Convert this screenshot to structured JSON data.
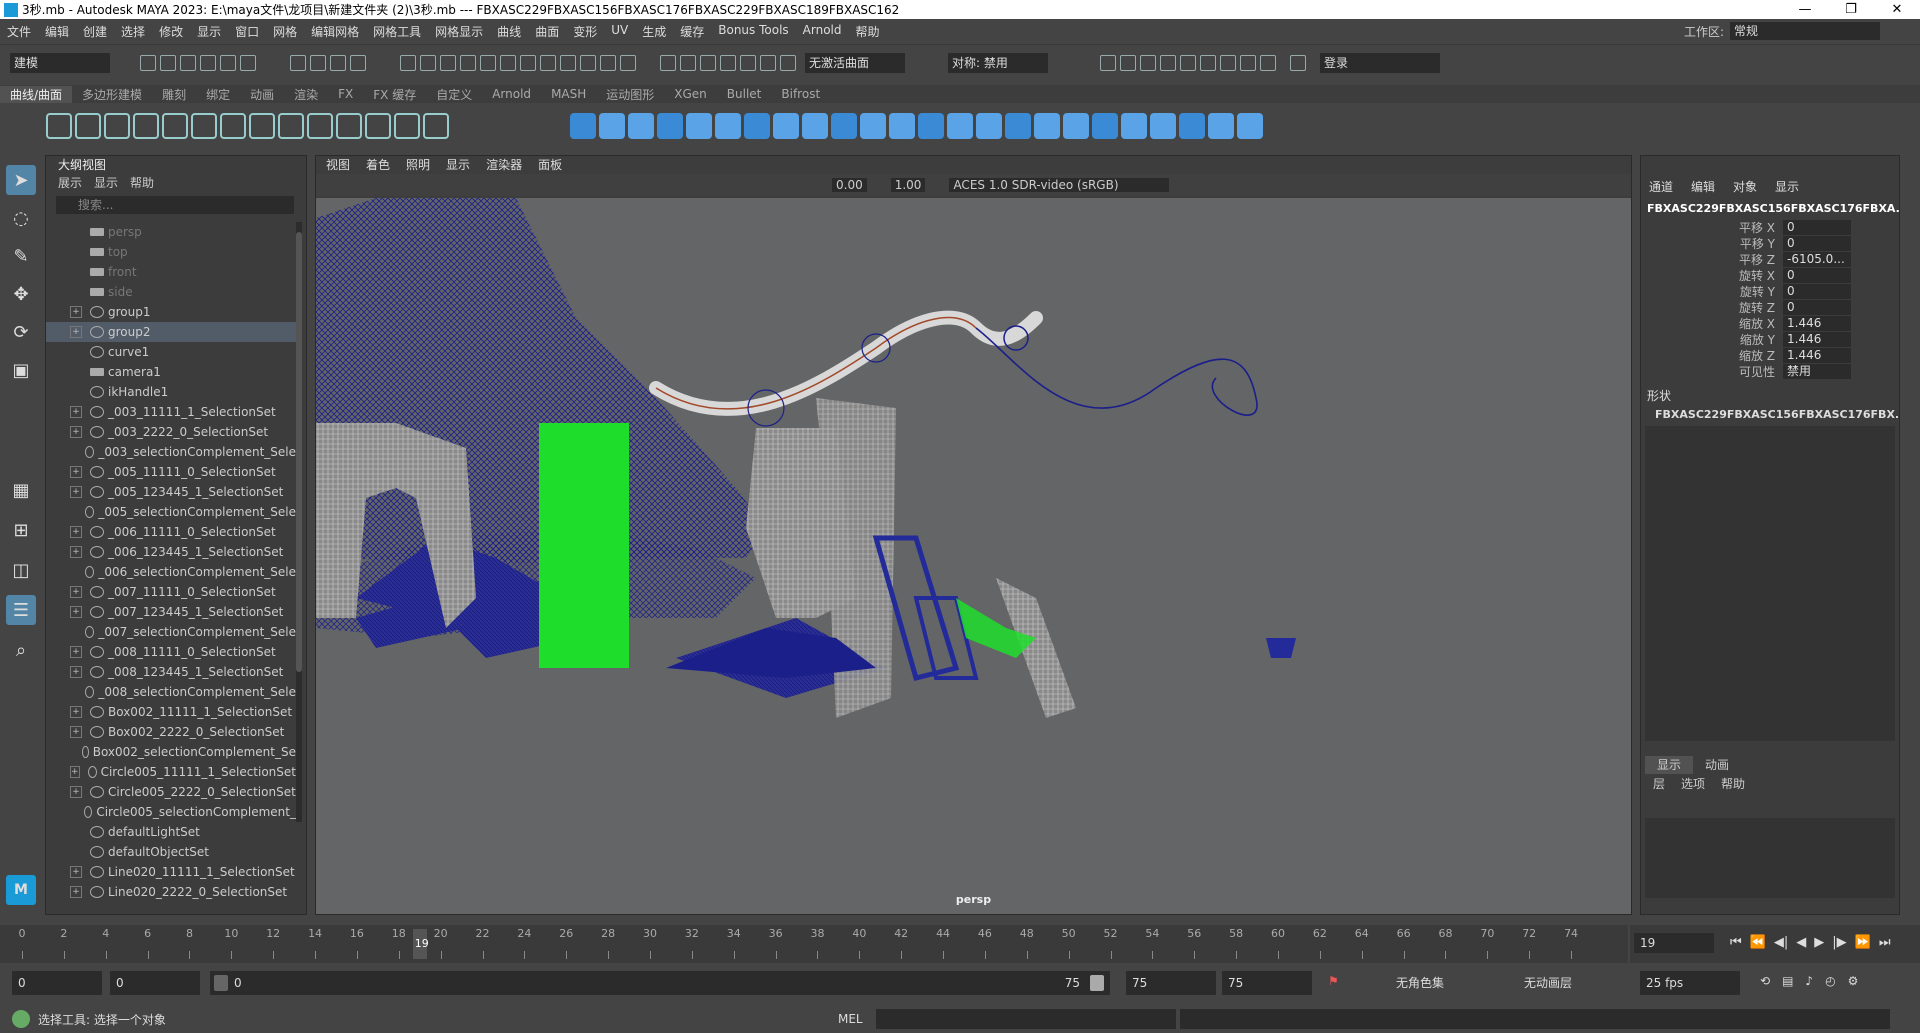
{
  "window": {
    "title": "3秒.mb - Autodesk MAYA 2023: E:\\maya文件\\龙项目\\新建文件夹 (2)\\3秒.mb   ---   FBXASC229FBXASC156FBXASC176FBXASC229FBXASC189FBXASC162",
    "minimize": "—",
    "maximize": "❐",
    "close": "✕"
  },
  "menubar": {
    "items": [
      "文件",
      "编辑",
      "创建",
      "选择",
      "修改",
      "显示",
      "窗口",
      "网格",
      "编辑网格",
      "网格工具",
      "网格显示",
      "曲线",
      "曲面",
      "变形",
      "UV",
      "生成",
      "缓存",
      "Bonus Tools",
      "Arnold",
      "帮助"
    ],
    "workspace_label": "工作区:",
    "workspace_value": "常规"
  },
  "statusline": {
    "mode": "建模",
    "live_surface": "无激活曲面",
    "symmetry": "对称: 禁用",
    "login": "登录"
  },
  "shelf": {
    "tabs": [
      "曲线/曲面",
      "多边形建模",
      "雕刻",
      "绑定",
      "动画",
      "渲染",
      "FX",
      "FX 缓存",
      "自定义",
      "Arnold",
      "MASH",
      "运动图形",
      "XGen",
      "Bullet",
      "Bifrost"
    ],
    "active_tab": 0
  },
  "outliner": {
    "title": "大纲视图",
    "menu": [
      "展示",
      "显示",
      "帮助"
    ],
    "search_placeholder": "搜索...",
    "rows": [
      {
        "label": "persp",
        "type": "cam",
        "dim": true,
        "expand": false
      },
      {
        "label": "top",
        "type": "cam",
        "dim": true,
        "expand": false
      },
      {
        "label": "front",
        "type": "cam",
        "dim": true,
        "expand": false
      },
      {
        "label": "side",
        "type": "cam",
        "dim": true,
        "expand": false
      },
      {
        "label": "group1",
        "type": "grp",
        "expand": true
      },
      {
        "label": "group2",
        "type": "grp",
        "expand": true,
        "selected": true
      },
      {
        "label": "curve1",
        "type": "crv",
        "expand": false
      },
      {
        "label": "camera1",
        "type": "cam",
        "expand": false
      },
      {
        "label": "ikHandle1",
        "type": "ik",
        "expand": false
      },
      {
        "label": "_003_11111_1_SelectionSet",
        "type": "set",
        "expand": true
      },
      {
        "label": "_003_2222_0_SelectionSet",
        "type": "set",
        "expand": true
      },
      {
        "label": "_003_selectionComplement_Sele",
        "type": "set",
        "expand": false
      },
      {
        "label": "_005_11111_0_SelectionSet",
        "type": "set",
        "expand": true
      },
      {
        "label": "_005_123445_1_SelectionSet",
        "type": "set",
        "expand": true
      },
      {
        "label": "_005_selectionComplement_Sele",
        "type": "set",
        "expand": false
      },
      {
        "label": "_006_11111_0_SelectionSet",
        "type": "set",
        "expand": true
      },
      {
        "label": "_006_123445_1_SelectionSet",
        "type": "set",
        "expand": true
      },
      {
        "label": "_006_selectionComplement_Sele",
        "type": "set",
        "expand": false
      },
      {
        "label": "_007_11111_0_SelectionSet",
        "type": "set",
        "expand": true
      },
      {
        "label": "_007_123445_1_SelectionSet",
        "type": "set",
        "expand": true
      },
      {
        "label": "_007_selectionComplement_Sele",
        "type": "set",
        "expand": false
      },
      {
        "label": "_008_11111_0_SelectionSet",
        "type": "set",
        "expand": true
      },
      {
        "label": "_008_123445_1_SelectionSet",
        "type": "set",
        "expand": true
      },
      {
        "label": "_008_selectionComplement_Sele",
        "type": "set",
        "expand": false
      },
      {
        "label": "Box002_11111_1_SelectionSet",
        "type": "set",
        "expand": true
      },
      {
        "label": "Box002_2222_0_SelectionSet",
        "type": "set",
        "expand": true
      },
      {
        "label": "Box002_selectionComplement_Se",
        "type": "set",
        "expand": false
      },
      {
        "label": "Circle005_11111_1_SelectionSet",
        "type": "set",
        "expand": true
      },
      {
        "label": "Circle005_2222_0_SelectionSet",
        "type": "set",
        "expand": true
      },
      {
        "label": "Circle005_selectionComplement_",
        "type": "set",
        "expand": false
      },
      {
        "label": "defaultLightSet",
        "type": "set",
        "expand": false
      },
      {
        "label": "defaultObjectSet",
        "type": "set",
        "expand": false
      },
      {
        "label": "Line020_11111_1_SelectionSet",
        "type": "set",
        "expand": true
      },
      {
        "label": "Line020_2222_0_SelectionSet",
        "type": "set",
        "expand": true
      }
    ]
  },
  "viewport": {
    "menu": [
      "视图",
      "着色",
      "照明",
      "显示",
      "渲染器",
      "面板"
    ],
    "exposure": "0.00",
    "gamma": "1.00",
    "color_space": "ACES 1.0 SDR-video (sRGB)",
    "camera": "persp"
  },
  "channelbox": {
    "menu": [
      "通道",
      "编辑",
      "对象",
      "显示"
    ],
    "object": "FBXASC229FBXASC156FBXASC176FBXA...",
    "attrs": [
      {
        "label": "平移 X",
        "value": "0"
      },
      {
        "label": "平移 Y",
        "value": "0"
      },
      {
        "label": "平移 Z",
        "value": "-6105.0..."
      },
      {
        "label": "旋转 X",
        "value": "0"
      },
      {
        "label": "旋转 Y",
        "value": "0"
      },
      {
        "label": "旋转 Z",
        "value": "0"
      },
      {
        "label": "缩放 X",
        "value": "1.446"
      },
      {
        "label": "缩放 Y",
        "value": "1.446"
      },
      {
        "label": "缩放 Z",
        "value": "1.446"
      },
      {
        "label": "可见性",
        "value": "禁用"
      }
    ],
    "shapes_label": "形状",
    "shape_object": "FBXASC229FBXASC156FBXASC176FBX...",
    "layer_tabs": [
      "显示",
      "动画"
    ],
    "layer_menu": [
      "层",
      "选项",
      "帮助"
    ]
  },
  "timeline": {
    "ticks": [
      "0",
      "2",
      "4",
      "6",
      "8",
      "10",
      "12",
      "14",
      "16",
      "18",
      "20",
      "22",
      "24",
      "26",
      "28",
      "30",
      "32",
      "34",
      "36",
      "38",
      "40",
      "42",
      "44",
      "46",
      "48",
      "50",
      "52",
      "54",
      "56",
      "58",
      "60",
      "62",
      "64",
      "66",
      "68",
      "70",
      "72",
      "74"
    ],
    "current_frame": "19",
    "current_frame_field": "19"
  },
  "range": {
    "start_anim": "0",
    "start": "0",
    "slider_start": "0",
    "slider_end": "75",
    "end": "75",
    "end_anim": "75",
    "char_set": "无角色集",
    "anim_layer": "无动画层",
    "fps": "25 fps"
  },
  "helpline": {
    "text": "选择工具: 选择一个对象",
    "mel": "MEL"
  }
}
